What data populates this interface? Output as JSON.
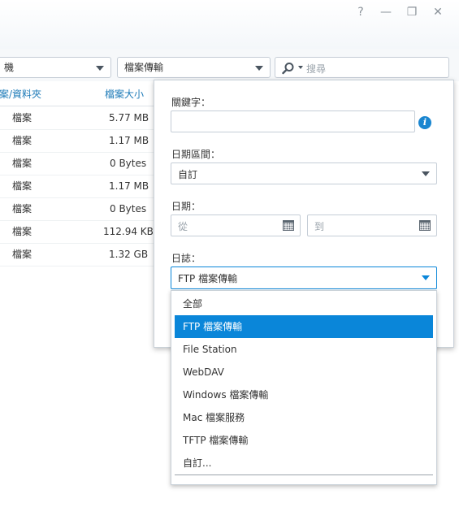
{
  "window": {
    "controls": [
      {
        "name": "help-icon",
        "glyph": "?"
      },
      {
        "name": "minimize-icon",
        "glyph": "—"
      },
      {
        "name": "restore-icon",
        "glyph": "❐"
      },
      {
        "name": "close-icon",
        "glyph": "✕"
      }
    ]
  },
  "toolbar": {
    "filter1_value": "機",
    "filter2_value": "檔案傳輸",
    "search_placeholder": "搜尋"
  },
  "table": {
    "headers": [
      "案/資料夾",
      "檔案大小"
    ],
    "rows": [
      {
        "type": "檔案",
        "size": "5.77 MB"
      },
      {
        "type": "檔案",
        "size": "1.17 MB"
      },
      {
        "type": "檔案",
        "size": "0 Bytes"
      },
      {
        "type": "檔案",
        "size": "1.17 MB"
      },
      {
        "type": "檔案",
        "size": "0 Bytes"
      },
      {
        "type": "檔案",
        "size": "112.94 KB"
      },
      {
        "type": "檔案",
        "size": "1.32 GB"
      }
    ]
  },
  "search_panel": {
    "keyword_label": "關鍵字：",
    "keyword_value": "",
    "info_icon": "i",
    "date_range_label": "日期區間：",
    "date_range_value": "自訂",
    "date_label": "日期：",
    "from_placeholder": "從",
    "to_placeholder": "到",
    "log_label": "日誌：",
    "log_value": "FTP 檔案傳輸"
  },
  "log_options": {
    "items": [
      "全部",
      "FTP 檔案傳輸",
      "File Station",
      "WebDAV",
      "Windows 檔案傳輸",
      "Mac 檔案服務",
      "TFTP 檔案傳輸",
      "自訂..."
    ],
    "selected": "FTP 檔案傳輸"
  },
  "colors": {
    "accent": "#0a86d9",
    "header_text": "#1e7bb8"
  }
}
